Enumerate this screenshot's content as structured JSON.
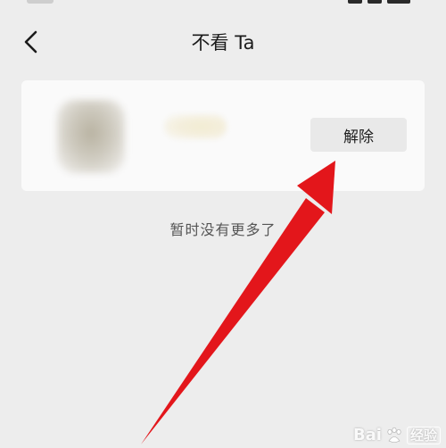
{
  "nav": {
    "title": "不看 Ta"
  },
  "user_card": {
    "unblock_label": "解除"
  },
  "empty_hint": "暂时没有更多了",
  "annotation": {
    "arrow_color": "#e3161b"
  },
  "watermark": {
    "brand": "Bai",
    "suffix": "经验"
  },
  "icons": {
    "back": "chevron-left-icon",
    "watermark": "baidu-paw-icon"
  }
}
